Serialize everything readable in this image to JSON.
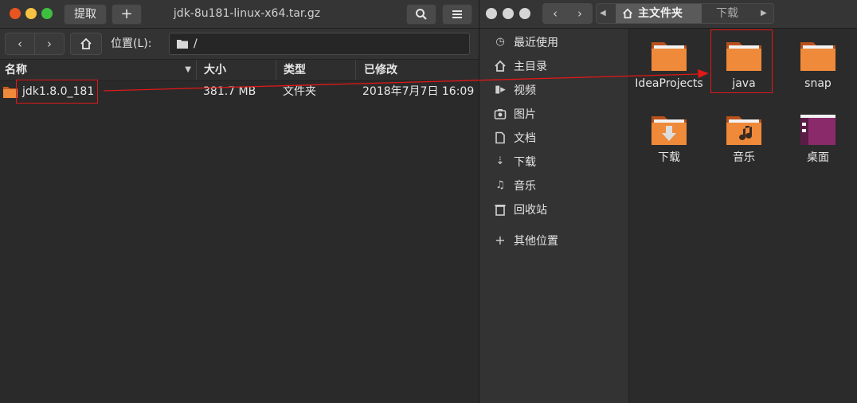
{
  "left": {
    "extract_button": "提取",
    "add_button": "+",
    "window_title": "jdk-8u181-linux-x64.tar.gz",
    "location_label": "位置(L):",
    "location_path": "/",
    "columns": {
      "name": "名称",
      "size": "大小",
      "type": "类型",
      "modified": "已修改"
    },
    "file": {
      "name": "jdk1.8.0_181",
      "size": "381.7 MB",
      "type": "文件夹",
      "modified": "2018年7月7日 16:09"
    }
  },
  "right": {
    "breadcrumb": {
      "home": "主文件夹",
      "downloads": "下载"
    },
    "sidebar": [
      {
        "label": "最近使用",
        "icon": "clock-icon"
      },
      {
        "label": "主目录",
        "icon": "home-icon"
      },
      {
        "label": "视频",
        "icon": "video-icon"
      },
      {
        "label": "图片",
        "icon": "camera-icon"
      },
      {
        "label": "文档",
        "icon": "document-icon"
      },
      {
        "label": "下载",
        "icon": "download-icon"
      },
      {
        "label": "音乐",
        "icon": "music-icon"
      },
      {
        "label": "回收站",
        "icon": "trash-icon"
      },
      {
        "label": "其他位置",
        "icon": "plus-icon"
      }
    ],
    "folders": [
      {
        "label": "IdeaProjects",
        "icon": "folder-icon"
      },
      {
        "label": "java",
        "icon": "folder-icon"
      },
      {
        "label": "snap",
        "icon": "folder-icon"
      },
      {
        "label": "下载",
        "icon": "folder-download-icon"
      },
      {
        "label": "音乐",
        "icon": "folder-music-icon"
      },
      {
        "label": "桌面",
        "icon": "folder-desktop-icon"
      }
    ]
  },
  "colors": {
    "annotation_red": "#e01818",
    "folder_orange": "#e8742e"
  }
}
